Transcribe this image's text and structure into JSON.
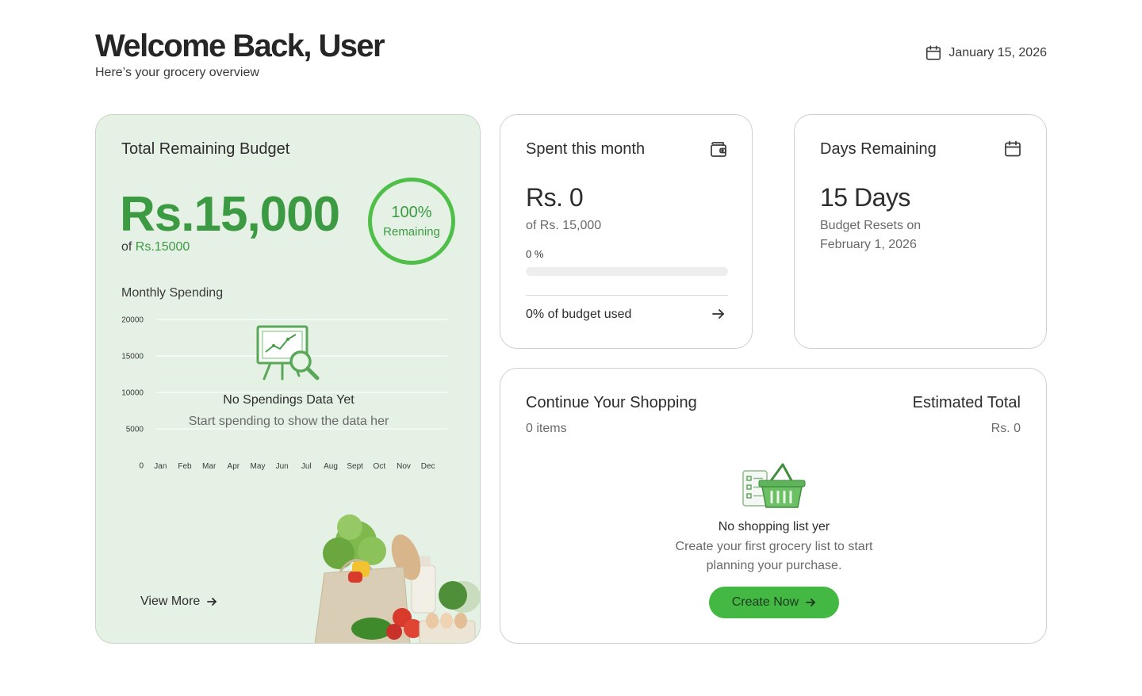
{
  "header": {
    "title": "Welcome Back, User",
    "subtitle": "Here’s your grocery overview",
    "date": "January 15, 2026"
  },
  "budget": {
    "title": "Total Remaining Budget",
    "amount": "Rs.15,000",
    "of_prefix": "of ",
    "of_value": "Rs.15000",
    "ring_percent": "100%",
    "ring_label": "Remaining",
    "remaining_fraction": 1.0,
    "monthly_label": "Monthly Spending",
    "empty_title": "No Spendings Data Yet",
    "empty_text": "Start spending to show the data her",
    "view_more": "View More"
  },
  "chart_data": {
    "type": "line",
    "categories": [
      "Jan",
      "Feb",
      "Mar",
      "Apr",
      "May",
      "Jun",
      "Jul",
      "Aug",
      "Sept",
      "Oct",
      "Nov",
      "Dec"
    ],
    "y_ticks": [
      0,
      5000,
      10000,
      15000,
      20000
    ],
    "ylim": [
      0,
      20000
    ],
    "series": [],
    "grid": true,
    "title": "Monthly Spending",
    "xlabel": "",
    "ylabel": ""
  },
  "spent": {
    "title": "Spent this month",
    "value": "Rs. 0",
    "of_text": "of Rs. 15,000",
    "percent_text": "0 %",
    "progress": 0,
    "used_text": "0% of budget used"
  },
  "days": {
    "title": "Days Remaining",
    "value": "15 Days",
    "reset_label": "Budget Resets on",
    "reset_date": "February 1, 2026"
  },
  "shopping": {
    "title": "Continue Your Shopping",
    "items": "0 items",
    "total_label": "Estimated Total",
    "total_value": "Rs. 0",
    "empty_title": "No shopping list yer",
    "empty_text": "Create your first grocery list to start planning your purchase.",
    "button": "Create Now"
  },
  "colors": {
    "accent": "#3c9a43",
    "button": "#43b843",
    "budget_card_bg": "#e5f1e4"
  },
  "icons": {
    "date": "calendar-icon",
    "spent": "wallet-icon",
    "days": "calendar-icon",
    "arrow": "arrow-right-icon"
  }
}
